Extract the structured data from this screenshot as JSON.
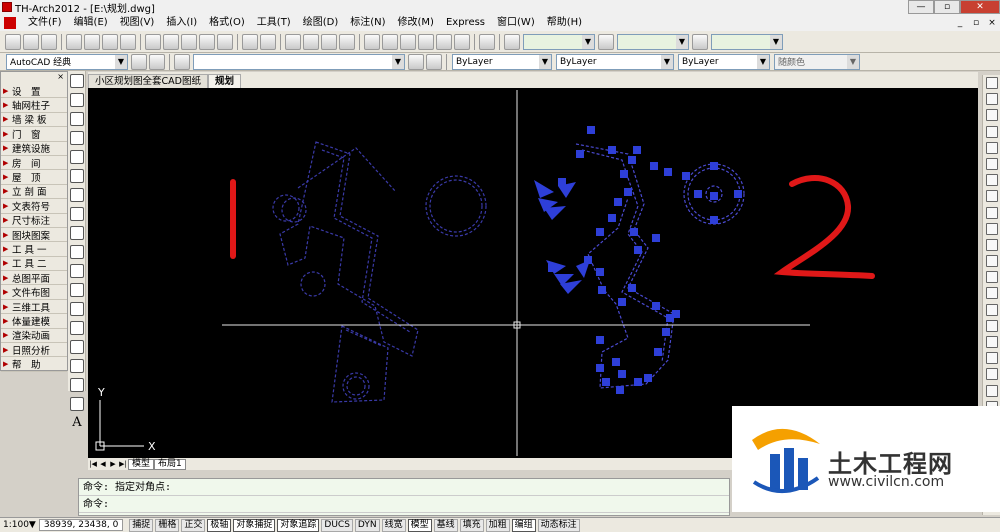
{
  "window": {
    "title": "TH-Arch2012 - [E:\\规划.dwg]"
  },
  "menu": [
    "文件(F)",
    "编辑(E)",
    "视图(V)",
    "插入(I)",
    "格式(O)",
    "工具(T)",
    "绘图(D)",
    "标注(N)",
    "修改(M)",
    "Express",
    "窗口(W)",
    "帮助(H)"
  ],
  "toolbar": {
    "workspace": "AutoCAD 经典",
    "layer": "ByLayer",
    "linetype": "ByLayer",
    "lineweight": "ByLayer",
    "color": "随颜色"
  },
  "left_panel": {
    "items": [
      "设　置",
      "轴网柱子",
      "墙 梁 板",
      "门　窗",
      "建筑设施",
      "房　间",
      "屋　顶",
      "立 剖 面",
      "文表符号",
      "尺寸标注",
      "图块图案",
      "工 具 一",
      "工 具 二",
      "总图平面",
      "文件布图",
      "三维工具",
      "体量建模",
      "渲染动画",
      "日照分析",
      "帮　助"
    ]
  },
  "text_tool_glyph": "A",
  "doc_tabs": [
    "小区规划图全套CAD图纸",
    "规划"
  ],
  "canvas": {
    "label_left": "1",
    "label_right": "2",
    "axis_x": "X",
    "axis_y": "Y"
  },
  "layout_tabs": [
    "模型",
    "布局1"
  ],
  "command": {
    "line1": "命令: 指定对角点:",
    "line2": "命令:"
  },
  "status": {
    "scale": "1:100▼",
    "coords": "38939, 23438, 0",
    "buttons": [
      "捕捉",
      "栅格",
      "正交",
      "极轴",
      "对象捕捉",
      "对象追踪",
      "DUCS",
      "DYN",
      "线宽",
      "模型",
      "基线",
      "填充",
      "加粗",
      "编组",
      "动态标注"
    ]
  },
  "watermark": {
    "text": "土木工程网",
    "url": "www.civilcn.com"
  }
}
